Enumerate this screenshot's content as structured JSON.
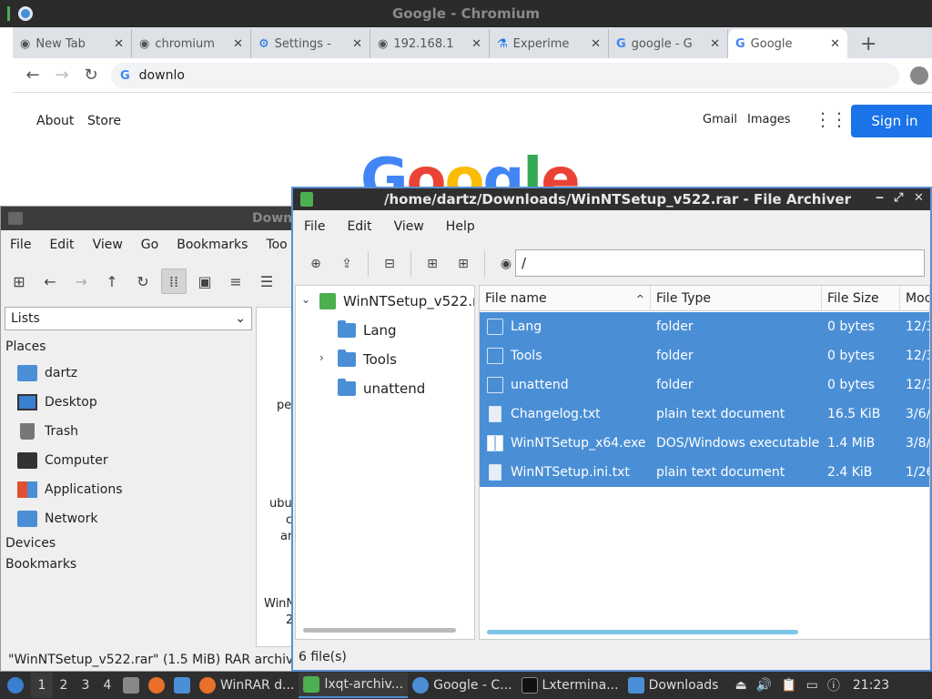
{
  "chromium": {
    "title": "Google - Chromium",
    "tabs": [
      {
        "label": "New Tab",
        "icon": "globe-icon"
      },
      {
        "label": "chromium",
        "icon": "globe-icon"
      },
      {
        "label": "Settings -",
        "icon": "gear-icon"
      },
      {
        "label": "192.168.1",
        "icon": "globe-icon"
      },
      {
        "label": "Experime",
        "icon": "flask-icon"
      },
      {
        "label": "google - G",
        "icon": "google-icon"
      },
      {
        "label": "Google",
        "icon": "google-icon",
        "active": true
      }
    ],
    "address": "downlo",
    "page": {
      "about": "About",
      "store": "Store",
      "gmail": "Gmail",
      "images": "Images",
      "signin": "Sign in",
      "logo": "Google"
    }
  },
  "filemanager": {
    "title": "Down",
    "menu": [
      "File",
      "Edit",
      "View",
      "Go",
      "Bookmarks",
      "Too"
    ],
    "view_mode": "Lists",
    "places_label": "Places",
    "places": [
      {
        "label": "dartz",
        "icon": "home-folder-icon",
        "color": "#4a8fd6"
      },
      {
        "label": "Desktop",
        "icon": "desktop-icon",
        "color": "#3a7fd0"
      },
      {
        "label": "Trash",
        "icon": "trash-icon",
        "color": "#777777"
      },
      {
        "label": "Computer",
        "icon": "computer-icon",
        "color": "#333333"
      },
      {
        "label": "Applications",
        "icon": "applications-icon",
        "color": "#e05030"
      },
      {
        "label": "Network",
        "icon": "network-icon",
        "color": "#4a8fd6"
      }
    ],
    "devices_label": "Devices",
    "bookmarks_label": "Bookmarks",
    "content_fragments": [
      "pe",
      "ubu",
      "c",
      "ar",
      "WinN",
      "2"
    ],
    "status": "\"WinNTSetup_v522.rar\" (1.5 MiB) RAR archive"
  },
  "archiver": {
    "title": "/home/dartz/Downloads/WinNTSetup_v522.rar - File Archiver",
    "menu": [
      "File",
      "Edit",
      "View",
      "Help"
    ],
    "path": "/",
    "tree": {
      "root": "WinNTSetup_v522.ra",
      "children": [
        "Lang",
        "Tools",
        "unattend"
      ]
    },
    "columns": [
      "File name",
      "File Type",
      "File Size",
      "Moc"
    ],
    "files": [
      {
        "name": "Lang",
        "type": "folder",
        "size": "0 bytes",
        "date": "12/3"
      },
      {
        "name": "Tools",
        "type": "folder",
        "size": "0 bytes",
        "date": "12/3"
      },
      {
        "name": "unattend",
        "type": "folder",
        "size": "0 bytes",
        "date": "12/3"
      },
      {
        "name": "Changelog.txt",
        "type": "plain text document",
        "size": "16.5 KiB",
        "date": "3/6/"
      },
      {
        "name": "WinNTSetup_x64.exe",
        "type": "DOS/Windows executable",
        "size": "1.4 MiB",
        "date": "3/8/"
      },
      {
        "name": "WinNTSetup.ini.txt",
        "type": "plain text document",
        "size": "2.4 KiB",
        "date": "1/26"
      }
    ],
    "status": "6 file(s)",
    "selection_color": "#4a8fd6"
  },
  "taskbar": {
    "workspaces": [
      "1",
      "2",
      "3",
      "4"
    ],
    "items": [
      {
        "label": "WinRAR d...",
        "icon": "firefox-icon"
      },
      {
        "label": "lxqt-archiv...",
        "icon": "archive-icon"
      },
      {
        "label": "Google - C...",
        "icon": "chromium-icon"
      },
      {
        "label": "Lxtermina...",
        "icon": "terminal-icon"
      },
      {
        "label": "Downloads",
        "icon": "folder-icon"
      }
    ],
    "clock": "21:23"
  }
}
